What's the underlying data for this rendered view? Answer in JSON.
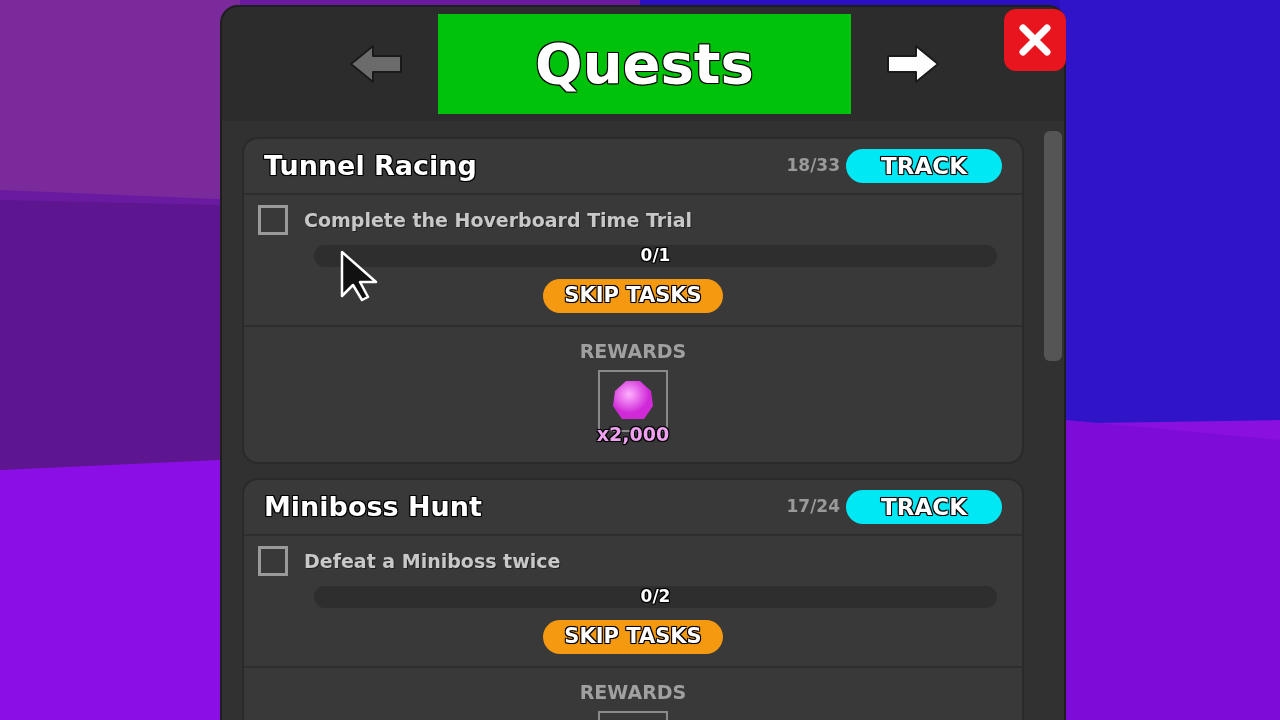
{
  "header": {
    "title": "Quests",
    "previous_disabled": true,
    "next_disabled": false
  },
  "quests": [
    {
      "name": "Tunnel Racing",
      "count": "18/33",
      "track_label": "TRACK",
      "tasks": [
        {
          "text": "Complete the Hoverboard Time Trial",
          "checked": false,
          "level": 0,
          "progress": "0/1"
        }
      ],
      "skip_label": "SKIP TASKS",
      "rewards_label": "REWARDS",
      "rewards": [
        {
          "kind": "gem",
          "amount": "x2,000"
        }
      ]
    },
    {
      "name": "Miniboss Hunt",
      "count": "17/24",
      "track_label": "TRACK",
      "tasks": [
        {
          "text": "Defeat a Miniboss twice",
          "checked": false,
          "level": 0,
          "progress": "0/2"
        }
      ],
      "skip_label": "SKIP TASKS",
      "rewards_label": "REWARDS",
      "rewards": [
        {
          "kind": "slot"
        }
      ]
    }
  ]
}
